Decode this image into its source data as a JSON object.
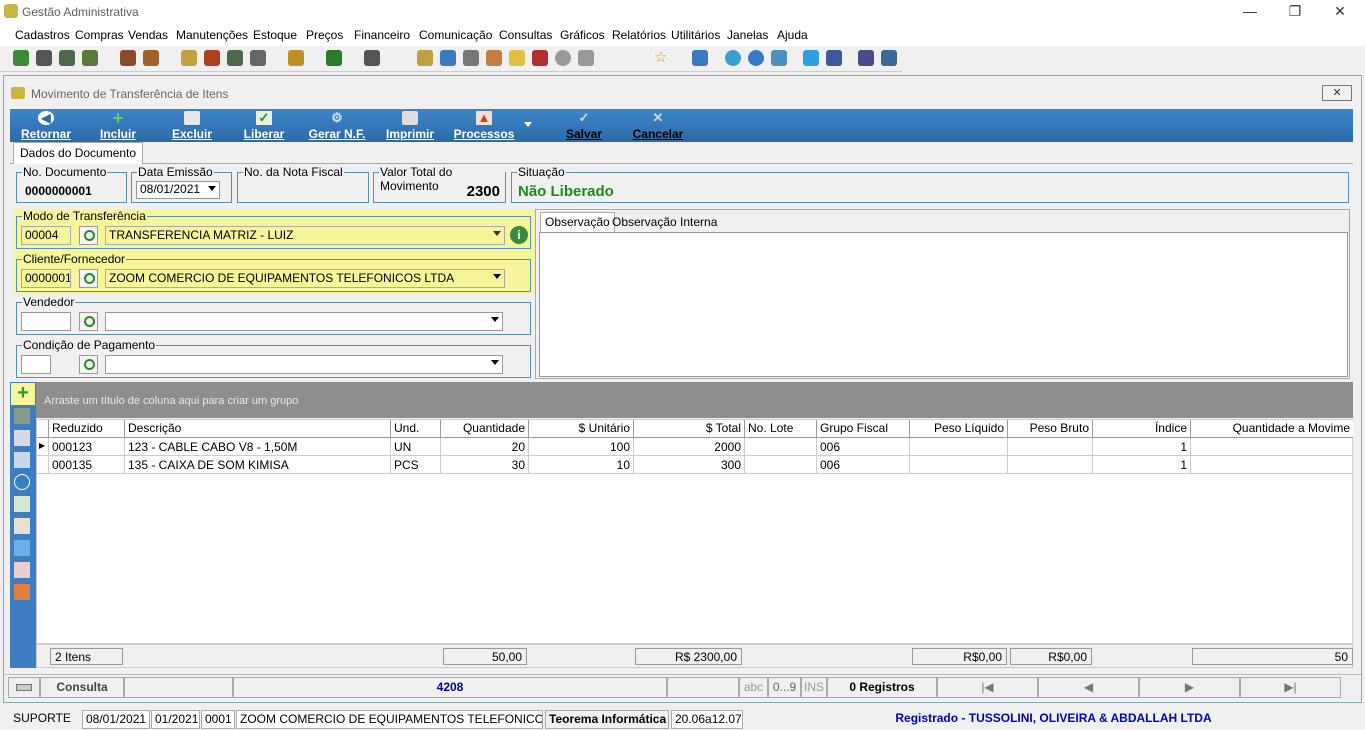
{
  "app_title": "Gestão Administrativa",
  "window_controls": {
    "minimize": "—",
    "maximize": "❐",
    "close": "✕"
  },
  "menu": [
    "Cadastros",
    "Compras",
    "Vendas",
    "Manutenções",
    "Estoque",
    "Preços",
    "Financeiro",
    "Comunicação",
    "Consultas",
    "Gráficos",
    "Relatórios",
    "Utilitários",
    "Janelas",
    "Ajuda"
  ],
  "child_title": "Movimento de Transferência de Itens",
  "ribbon": {
    "retornar": "Retornar",
    "incluir": "Incluir",
    "excluir": "Excluir",
    "liberar": "Liberar",
    "gerar_nf": "Gerar N.F.",
    "imprimir": "Imprimir",
    "processos": "Processos",
    "salvar": "Salvar",
    "cancelar": "Cancelar"
  },
  "tab_doc": "Dados do Documento",
  "doc": {
    "no_documento_label": "No. Documento",
    "no_documento": "0000000001",
    "data_emissao_label": "Data Emissão",
    "data_emissao": "08/01/2021",
    "nota_fiscal_label": "No. da Nota Fiscal",
    "valor_total_label": "Valor Total do Movimento",
    "valor_total": "2300",
    "situacao_label": "Situação",
    "situacao": "Não Liberado"
  },
  "modo": {
    "label": "Modo de Transferência",
    "code": "00004",
    "value": "TRANSFERENCIA MATRIZ - LUIZ"
  },
  "cliente": {
    "label": "Cliente/Fornecedor",
    "code": "0000001",
    "value": "ZOOM COMERCIO DE EQUIPAMENTOS TELEFONICOS LTDA"
  },
  "vendedor": {
    "label": "Vendedor",
    "code": "",
    "value": ""
  },
  "condicao": {
    "label": "Condição de Pagamento",
    "code": "",
    "value": ""
  },
  "obs_tabs": [
    "Observação",
    "Observação Interna"
  ],
  "group_hint": "Arraste um título de coluna aqui para criar um grupo",
  "columns": [
    "Reduzido",
    "Descrição",
    "Und.",
    "Quantidade",
    "$ Unitário",
    "$ Total",
    "No. Lote",
    "Grupo Fiscal",
    "Peso Líquido",
    "Peso Bruto",
    "Índice",
    "Quantidade a Movime"
  ],
  "rows": [
    [
      "000123",
      "123 - CABLE CABO V8 - 1,50M",
      "UN",
      "20",
      "100",
      "2000",
      "",
      "006",
      "",
      "",
      "1",
      ""
    ],
    [
      "000135",
      "135 - CAIXA DE SOM KIMISA",
      "PCS",
      "30",
      "10",
      "300",
      "",
      "006",
      "",
      "",
      "1",
      ""
    ]
  ],
  "footer": {
    "itens": "2 Itens",
    "quantidade": "50,00",
    "total": "R$ 2300,00",
    "peso_liq": "R$0,00",
    "peso_bruto": "R$0,00",
    "qtd_mov": "50"
  },
  "status": {
    "mode": "Consulta",
    "number": "4208",
    "abc": "abc",
    "digits": "0...9",
    "ins": "INS",
    "registros": "0 Registros",
    "first": "|◀",
    "prev": "◀",
    "next": "▶",
    "last": "▶|"
  },
  "bottom": {
    "user": "SUPORTE",
    "date": "08/01/2021",
    "period": "01/2021",
    "code": "0001",
    "company": "ZOOM COMERCIO DE EQUIPAMENTOS TELEFONICOS LTDA",
    "vendor": "Teorema Informática",
    "version": "20.06a12.07b",
    "registered": "Registrado - TUSSOLINI, OLIVEIRA & ABDALLAH LTDA"
  },
  "colors": {
    "ribbon": "#2d6aa8",
    "highlight": "#f7f59a",
    "status_green": "#1a8a1a",
    "registered_blue": "#0000c0"
  }
}
